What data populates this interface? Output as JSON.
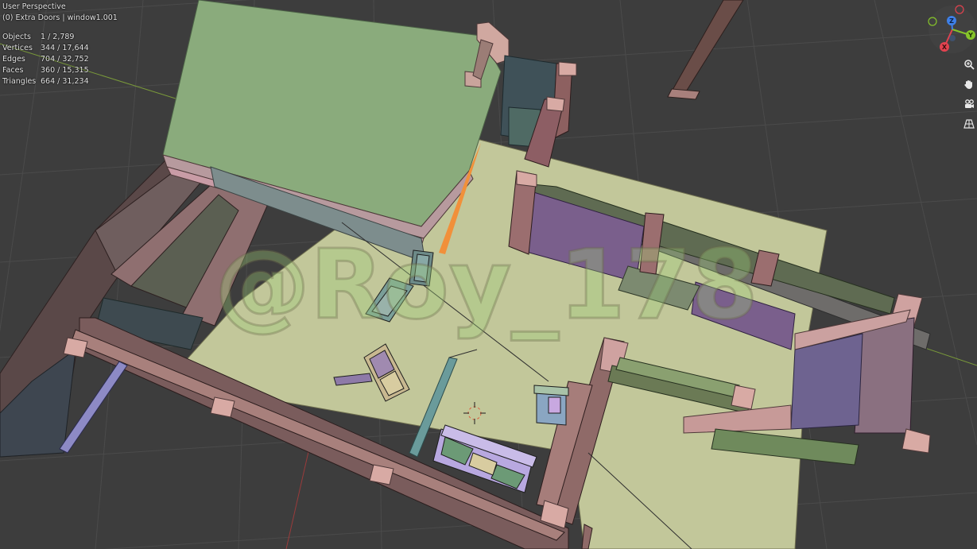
{
  "viewport": {
    "view_name": "User Perspective",
    "collection_label": "(0) Extra Doors | window1.001",
    "stats": [
      {
        "label": "Objects",
        "value": "1 / 2,789"
      },
      {
        "label": "Vertices",
        "value": "344 / 17,644"
      },
      {
        "label": "Edges",
        "value": "704 / 32,752"
      },
      {
        "label": "Faces",
        "value": "360 / 15,315"
      },
      {
        "label": "Triangles",
        "value": "664 / 31,234"
      }
    ],
    "watermark": "@Roy_178"
  },
  "gizmo": {
    "x_label": "X",
    "y_label": "Y",
    "z_label": "Z",
    "x_color": "#e2424f",
    "y_color": "#86c42a",
    "z_color": "#3e80e8"
  },
  "nav_tools": [
    {
      "icon": "zoom-icon"
    },
    {
      "icon": "hand-pan-icon"
    },
    {
      "icon": "camera-icon"
    },
    {
      "icon": "grid-perspective-icon"
    }
  ],
  "colors": {
    "background": "#3d3d3d",
    "grid_line": "#4d4d4d",
    "floor": "#c2c79a",
    "roof": "#8aab7c",
    "wall_frame": "#9a6e6e",
    "window_purple": "#7d6b94",
    "selection_orange": "#f1903a"
  }
}
